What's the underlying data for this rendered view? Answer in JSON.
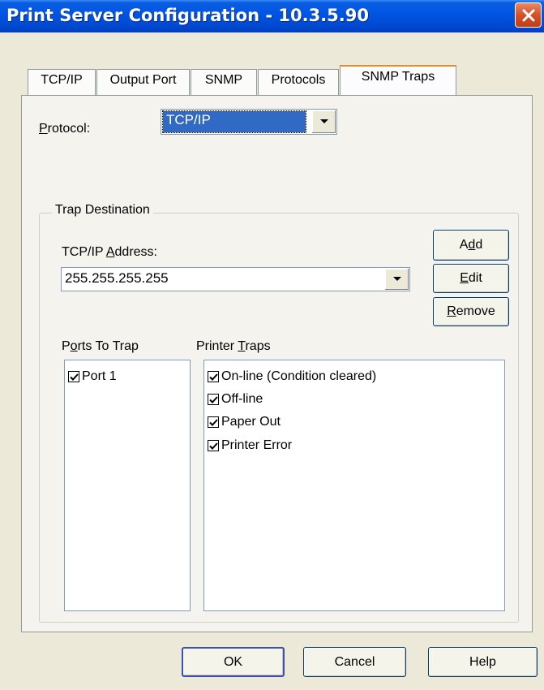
{
  "window": {
    "title": "Print Server Configuration - 10.3.5.90",
    "close_icon": "close-icon"
  },
  "tabs": [
    {
      "label": "TCP/IP",
      "active": false
    },
    {
      "label": "Output Port",
      "active": false
    },
    {
      "label": "SNMP",
      "active": false
    },
    {
      "label": "Protocols",
      "active": false
    },
    {
      "label": "SNMP Traps",
      "active": true
    }
  ],
  "protocol": {
    "label_prefix": "P",
    "label_rest": "rotocol:",
    "selected_value": "TCP/IP"
  },
  "trap_destination": {
    "group_label": "Trap Destination",
    "address_label_pre": "TCP/IP ",
    "address_label_ul": "A",
    "address_label_post": "ddress:",
    "address_value": "255.255.255.255",
    "add_button_pre": "A",
    "add_button_ul": "d",
    "add_button_post": "d",
    "edit_button_ul": "E",
    "edit_button_post": "dit",
    "remove_button_ul": "R",
    "remove_button_post": "emove"
  },
  "ports_to_trap": {
    "label_pre": "P",
    "label_ul": "o",
    "label_post": "rts To Trap",
    "items": [
      {
        "label": "Port 1",
        "checked": true
      }
    ]
  },
  "printer_traps": {
    "label_pre": "Printer ",
    "label_ul": "T",
    "label_post": "raps",
    "items": [
      {
        "label": "On-line (Condition cleared)",
        "checked": true
      },
      {
        "label": "Off-line",
        "checked": true
      },
      {
        "label": "Paper Out",
        "checked": true
      },
      {
        "label": "Printer Error",
        "checked": true
      }
    ]
  },
  "dialog_buttons": {
    "ok": "OK",
    "cancel": "Cancel",
    "help": "Help"
  },
  "colors": {
    "titlebar": "#0054e3",
    "selection": "#316ac5",
    "dialog_bg": "#ece9d8",
    "active_tab_accent": "#e68b2c"
  }
}
